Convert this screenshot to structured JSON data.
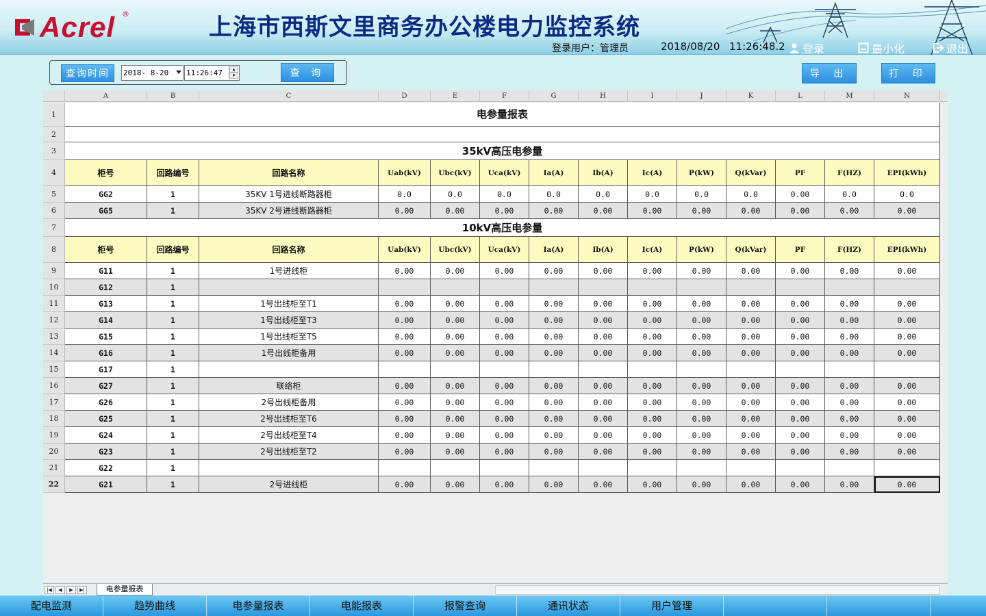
{
  "header": {
    "logo_text": "Acrel",
    "logo_reg": "®",
    "system_title": "上海市西斯文里商务办公楼电力监控系统",
    "login_user": "登录用户：管理员",
    "date": "2018/08/20",
    "time": "11:26:48.2",
    "login_label": "登录",
    "minimize_label": "最小化",
    "exit_label": "退出"
  },
  "query": {
    "time_button": "查询时间",
    "date_value": "2018- 8-20",
    "time_value": "11:26:47",
    "query_button": "查 询",
    "export_button": "导 出",
    "print_button": "打 印"
  },
  "sheet": {
    "columns": [
      "A",
      "B",
      "C",
      "D",
      "E",
      "F",
      "G",
      "H",
      "I",
      "J",
      "K",
      "L",
      "M",
      "N"
    ],
    "tab_name": "电参量报表",
    "report_title": "电参量报表",
    "section_35kv": "35kV高压电参量",
    "section_10kv": "10kV高压电参量",
    "headers": [
      "柜号",
      "回路编号",
      "回路名称",
      "Uab(kV)",
      "Ubc(kV)",
      "Uca(kV)",
      "Ia(A)",
      "Ib(A)",
      "Ic(A)",
      "P(kW)",
      "Q(kVar)",
      "PF",
      "F(HZ)",
      "EPI(kWh)"
    ],
    "rows_35kv": [
      {
        "rn": "5",
        "cab": "GG2",
        "loop": "1",
        "name": "35KV 1号进线断路器柜",
        "vals": [
          "0.0",
          "0.0",
          "0.0",
          "0.0",
          "0.0",
          "0.0",
          "0.0",
          "0.0",
          "0.00",
          "0.0",
          "0.0"
        ]
      },
      {
        "rn": "6",
        "cab": "GG5",
        "loop": "1",
        "name": "35KV 2号进线断路器柜",
        "vals": [
          "0.00",
          "0.00",
          "0.00",
          "0.00",
          "0.00",
          "0.00",
          "0.00",
          "0.00",
          "0.00",
          "0.00",
          "0.00"
        ]
      }
    ],
    "rows_10kv": [
      {
        "rn": "9",
        "cab": "G11",
        "loop": "1",
        "name": "1号进线柜",
        "vals": [
          "0.00",
          "0.00",
          "0.00",
          "0.00",
          "0.00",
          "0.00",
          "0.00",
          "0.00",
          "0.00",
          "0.00",
          "0.00"
        ]
      },
      {
        "rn": "10",
        "cab": "G12",
        "loop": "1",
        "name": "",
        "vals": [
          "",
          "",
          "",
          "",
          "",
          "",
          "",
          "",
          "",
          "",
          ""
        ]
      },
      {
        "rn": "11",
        "cab": "G13",
        "loop": "1",
        "name": "1号出线柜至T1",
        "vals": [
          "0.00",
          "0.00",
          "0.00",
          "0.00",
          "0.00",
          "0.00",
          "0.00",
          "0.00",
          "0.00",
          "0.00",
          "0.00"
        ]
      },
      {
        "rn": "12",
        "cab": "G14",
        "loop": "1",
        "name": "1号出线柜至T3",
        "vals": [
          "0.00",
          "0.00",
          "0.00",
          "0.00",
          "0.00",
          "0.00",
          "0.00",
          "0.00",
          "0.00",
          "0.00",
          "0.00"
        ]
      },
      {
        "rn": "13",
        "cab": "G15",
        "loop": "1",
        "name": "1号出线柜至T5",
        "vals": [
          "0.00",
          "0.00",
          "0.00",
          "0.00",
          "0.00",
          "0.00",
          "0.00",
          "0.00",
          "0.00",
          "0.00",
          "0.00"
        ]
      },
      {
        "rn": "14",
        "cab": "G16",
        "loop": "1",
        "name": "1号出线柜备用",
        "vals": [
          "0.00",
          "0.00",
          "0.00",
          "0.00",
          "0.00",
          "0.00",
          "0.00",
          "0.00",
          "0.00",
          "0.00",
          "0.00"
        ]
      },
      {
        "rn": "15",
        "cab": "G17",
        "loop": "1",
        "name": "",
        "vals": [
          "",
          "",
          "",
          "",
          "",
          "",
          "",
          "",
          "",
          "",
          ""
        ]
      },
      {
        "rn": "16",
        "cab": "G27",
        "loop": "1",
        "name": "联络柜",
        "vals": [
          "0.00",
          "0.00",
          "0.00",
          "0.00",
          "0.00",
          "0.00",
          "0.00",
          "0.00",
          "0.00",
          "0.00",
          "0.00"
        ]
      },
      {
        "rn": "17",
        "cab": "G26",
        "loop": "1",
        "name": "2号出线柜备用",
        "vals": [
          "0.00",
          "0.00",
          "0.00",
          "0.00",
          "0.00",
          "0.00",
          "0.00",
          "0.00",
          "0.00",
          "0.00",
          "0.00"
        ]
      },
      {
        "rn": "18",
        "cab": "G25",
        "loop": "1",
        "name": "2号出线柜至T6",
        "vals": [
          "0.00",
          "0.00",
          "0.00",
          "0.00",
          "0.00",
          "0.00",
          "0.00",
          "0.00",
          "0.00",
          "0.00",
          "0.00"
        ]
      },
      {
        "rn": "19",
        "cab": "G24",
        "loop": "1",
        "name": "2号出线柜至T4",
        "vals": [
          "0.00",
          "0.00",
          "0.00",
          "0.00",
          "0.00",
          "0.00",
          "0.00",
          "0.00",
          "0.00",
          "0.00",
          "0.00"
        ]
      },
      {
        "rn": "20",
        "cab": "G23",
        "loop": "1",
        "name": "2号出线柜至T2",
        "vals": [
          "0.00",
          "0.00",
          "0.00",
          "0.00",
          "0.00",
          "0.00",
          "0.00",
          "0.00",
          "0.00",
          "0.00",
          "0.00"
        ]
      },
      {
        "rn": "21",
        "cab": "G22",
        "loop": "1",
        "name": "",
        "vals": [
          "",
          "",
          "",
          "",
          "",
          "",
          "",
          "",
          "",
          "",
          ""
        ]
      },
      {
        "rn": "22",
        "cab": "G21",
        "loop": "1",
        "name": "2号进线柜",
        "vals": [
          "0.00",
          "0.00",
          "0.00",
          "0.00",
          "0.00",
          "0.00",
          "0.00",
          "0.00",
          "0.00",
          "0.00",
          "0.00"
        ]
      }
    ]
  },
  "nav": [
    "配电监测",
    "趋势曲线",
    "电参量报表",
    "电能报表",
    "报警查询",
    "通讯状态",
    "用户管理",
    "",
    ""
  ],
  "colors": {
    "header_bg": "#cdeef4",
    "header_row": "#fdfbc0",
    "stripe": "#e3e3e3",
    "nav": "#2b97de",
    "title": "#0b2b82",
    "logo": "#c8102e"
  }
}
